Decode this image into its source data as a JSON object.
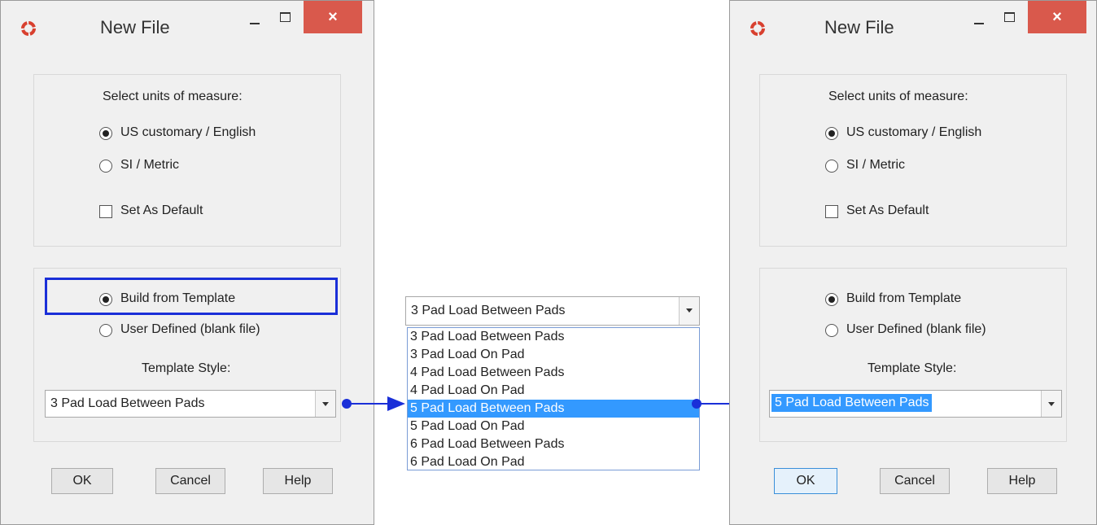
{
  "dialog": {
    "title": "New File",
    "close_glyph": "×",
    "units_label": "Select units of measure:",
    "unit_options": [
      "US customary / English",
      "SI / Metric"
    ],
    "set_default_label": "Set As Default",
    "build_options": [
      "Build from Template",
      "User Defined (blank file)"
    ],
    "template_style_label": "Template Style:",
    "ok_label": "OK",
    "cancel_label": "Cancel",
    "help_label": "Help"
  },
  "left_dialog": {
    "template_value": "3 Pad Load Between Pads"
  },
  "dropdown": {
    "current_value": "3 Pad Load Between Pads",
    "options": [
      "3 Pad Load Between Pads",
      "3 Pad Load On Pad",
      "4 Pad Load Between Pads",
      "4 Pad Load On Pad",
      "5 Pad Load Between Pads",
      "5 Pad Load On Pad",
      "6 Pad Load Between Pads",
      "6 Pad Load On Pad"
    ],
    "highlighted_option": "5 Pad Load Between Pads"
  },
  "right_dialog": {
    "template_value": "5 Pad Load Between Pads"
  },
  "colors": {
    "highlight": "#3399ff",
    "annotation": "#1a2fd8",
    "close": "#d9594c"
  },
  "icons": [
    "app-ring-icon",
    "minimize-icon",
    "maximize-icon",
    "close-icon",
    "chevron-down-icon",
    "arrow-right-icon"
  ]
}
